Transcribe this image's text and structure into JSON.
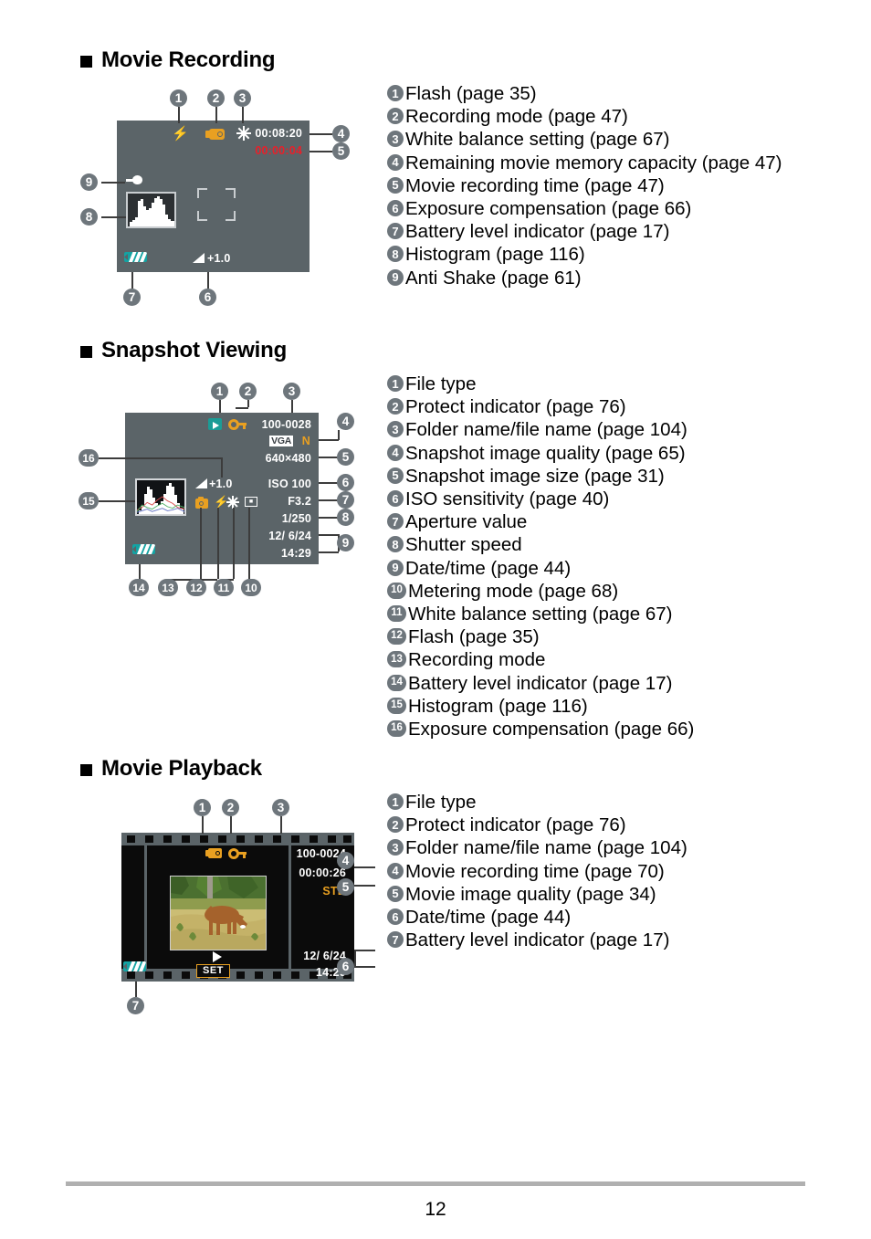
{
  "document": {
    "page_number": "12"
  },
  "sections": [
    {
      "id": "movie-recording",
      "title": "Movie Recording",
      "legend": [
        {
          "num": "1",
          "label": "Flash (page 35)"
        },
        {
          "num": "2",
          "label": "Recording mode (page 47)"
        },
        {
          "num": "3",
          "label": "White balance setting (page 67)"
        },
        {
          "num": "4",
          "label": "Remaining movie memory capacity (page 47)"
        },
        {
          "num": "5",
          "label": "Movie recording time (page 47)"
        },
        {
          "num": "6",
          "label": "Exposure compensation (page 66)"
        },
        {
          "num": "7",
          "label": "Battery level indicator (page 17)"
        },
        {
          "num": "8",
          "label": "Histogram (page 116)"
        },
        {
          "num": "9",
          "label": "Anti Shake (page 61)"
        }
      ],
      "screen": {
        "remaining_capacity": "00:08:20",
        "recording_time": "00:00:04",
        "exposure_compensation": "+1.0",
        "flash_icon": "flash-icon",
        "recording_mode_icon": "movie-mode-icon",
        "white_balance_icon": "daylight-white-balance-icon",
        "anti_shake_icon": "anti-shake-icon",
        "battery_icon": "battery-level-icon",
        "histogram_icon": "histogram",
        "focus_frame_icon": "focus-frame"
      },
      "callouts": [
        "1",
        "2",
        "3",
        "4",
        "5",
        "6",
        "7",
        "8",
        "9"
      ]
    },
    {
      "id": "snapshot-viewing",
      "title": "Snapshot Viewing",
      "legend": [
        {
          "num": "1",
          "label": "File type"
        },
        {
          "num": "2",
          "label": "Protect indicator (page 76)"
        },
        {
          "num": "3",
          "label": "Folder name/file name (page 104)"
        },
        {
          "num": "4",
          "label": "Snapshot image quality (page 65)"
        },
        {
          "num": "5",
          "label": "Snapshot image size (page 31)"
        },
        {
          "num": "6",
          "label": "ISO sensitivity (page 40)"
        },
        {
          "num": "7",
          "label": "Aperture value"
        },
        {
          "num": "8",
          "label": "Shutter speed"
        },
        {
          "num": "9",
          "label": "Date/time (page 44)"
        },
        {
          "num": "10",
          "label": "Metering mode (page 68)"
        },
        {
          "num": "11",
          "label": "White balance setting (page 67)"
        },
        {
          "num": "12",
          "label": "Flash (page 35)"
        },
        {
          "num": "13",
          "label": "Recording mode"
        },
        {
          "num": "14",
          "label": "Battery level indicator (page 17)"
        },
        {
          "num": "15",
          "label": "Histogram (page 116)"
        },
        {
          "num": "16",
          "label": "Exposure compensation (page 66)"
        }
      ],
      "screen": {
        "file_name": "100-0028",
        "quality_badge": "VGA",
        "quality_letter": "N",
        "image_size": "640×480",
        "iso": "ISO 100",
        "aperture": "F3.2",
        "shutter": "1/250",
        "date": "12/ 6/24",
        "time": "14:29",
        "exposure_compensation": "+1.0",
        "file_type_icon": "play-file-type-icon",
        "protect_icon": "key-protect-icon",
        "recording_mode_icon": "camera-mode-icon",
        "flash_icon": "flash-icon",
        "white_balance_icon": "daylight-white-balance-icon",
        "metering_icon": "metering-mode-icon",
        "battery_icon": "battery-level-icon"
      },
      "callouts": [
        "1",
        "2",
        "3",
        "4",
        "5",
        "6",
        "7",
        "8",
        "9",
        "10",
        "11",
        "12",
        "13",
        "14",
        "15",
        "16"
      ]
    },
    {
      "id": "movie-playback",
      "title": "Movie Playback",
      "legend": [
        {
          "num": "1",
          "label": "File type"
        },
        {
          "num": "2",
          "label": "Protect indicator (page 76)"
        },
        {
          "num": "3",
          "label": "Folder name/file name (page 104)"
        },
        {
          "num": "4",
          "label": "Movie recording time (page 70)"
        },
        {
          "num": "5",
          "label": "Movie image quality (page 34)"
        },
        {
          "num": "6",
          "label": "Date/time (page 44)"
        },
        {
          "num": "7",
          "label": "Battery level indicator (page 17)"
        }
      ],
      "screen": {
        "file_name": "100-0024",
        "recording_time": "00:00:26",
        "image_quality": "STD",
        "date": "12/ 6/24",
        "time": "14:29",
        "set_label": "SET",
        "file_type_icon": "movie-file-type-icon",
        "protect_icon": "key-protect-icon",
        "play_icon": "play-triangle-icon",
        "battery_icon": "battery-level-icon",
        "photo_subject": "deer-photo"
      },
      "callouts": [
        "1",
        "2",
        "3",
        "4",
        "5",
        "6",
        "7"
      ]
    }
  ],
  "colors": {
    "lcd_background": "#5b6468",
    "badge_gray": "#6e767c",
    "recording_red": "#e8202a",
    "accent_orange": "#e9a021",
    "battery_teal": "#14a3a3",
    "filmstrip_black": "#0b0b0b",
    "rule_gray": "#b0b0b0"
  }
}
